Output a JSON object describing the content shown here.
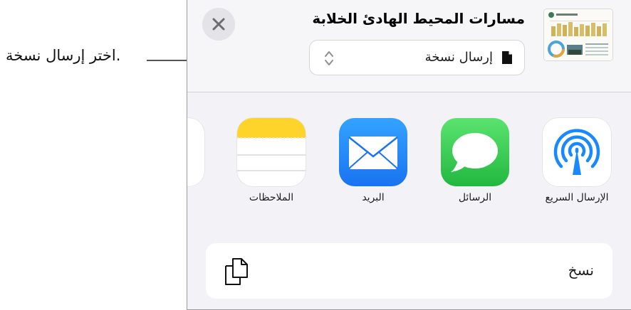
{
  "callout": {
    "text": "اختر إرسال نسخة."
  },
  "share_sheet": {
    "document_title": "مسارات المحيط الهادئ الخلابة",
    "send_option": {
      "label": "إرسال نسخة"
    },
    "apps": [
      {
        "name": "airdrop",
        "label": "الإرسال السريع",
        "icon": "airdrop-icon"
      },
      {
        "name": "messages",
        "label": "الرسائل",
        "icon": "messages-icon"
      },
      {
        "name": "mail",
        "label": "البريد",
        "icon": "mail-icon"
      },
      {
        "name": "notes",
        "label": "الملاحظات",
        "icon": "notes-icon"
      }
    ],
    "actions": {
      "copy_label": "نسخ"
    }
  },
  "colors": {
    "messages_green": "#34c759",
    "mail_blue": "#1a8cff",
    "notes_yellow": "#ffd42a",
    "airdrop_blue": "#1a88ff"
  }
}
